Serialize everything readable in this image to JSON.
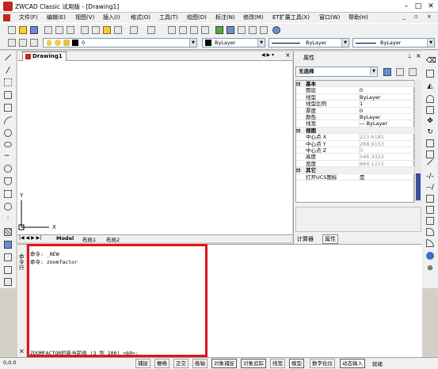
{
  "window": {
    "title": "ZWCAD Classic 试用版 - [Drawing1]"
  },
  "menu": [
    "文件(F)",
    "编辑(E)",
    "视图(V)",
    "插入(I)",
    "格式(O)",
    "工具(T)",
    "绘图(D)",
    "标注(N)",
    "修改(M)",
    "ET扩展工具(X)",
    "窗口(W)",
    "帮助(H)"
  ],
  "toolbar": {
    "layer_value": "0",
    "color_value": "ByLayer",
    "linetype_value": "ByLayer",
    "lineweight_value": "ByLayer"
  },
  "drawing": {
    "tab_label": "Drawing1",
    "axis_y": "Y",
    "axis_x": "X",
    "layout_tabs": [
      "Model",
      "布局1",
      "布局2"
    ]
  },
  "properties": {
    "title": "属性",
    "selection": "无选择",
    "rows": [
      {
        "type": "cat",
        "key": "基本"
      },
      {
        "key": "图层",
        "value": "0"
      },
      {
        "key": "线型",
        "value": "ByLayer"
      },
      {
        "key": "线型比例",
        "value": "1"
      },
      {
        "key": "厚度",
        "value": "0"
      },
      {
        "key": "颜色",
        "value": "ByLayer"
      },
      {
        "key": "线宽",
        "value": "— ByLayer"
      },
      {
        "type": "cat",
        "key": "视图"
      },
      {
        "key": "中心点 X",
        "value": "213.6181",
        "grey": true
      },
      {
        "key": "中心点 Y",
        "value": "268.9153",
        "grey": true
      },
      {
        "key": "中心点 Z",
        "value": "0",
        "grey": true
      },
      {
        "key": "高度",
        "value": "546.3322",
        "grey": true
      },
      {
        "key": "宽度",
        "value": "864.1215",
        "grey": true
      },
      {
        "type": "cat",
        "key": "其它"
      },
      {
        "key": "打开UCS图标",
        "value": "是"
      }
    ],
    "tabs": [
      "计算器",
      "属性"
    ]
  },
  "command": {
    "side_label": "命令行",
    "lines": [
      "命令: _NEW",
      "命令: zoomfactor"
    ],
    "prompt": "ZOOMFACTOR的新当前值 (3 到 100) <60>:"
  },
  "status": [
    "捕捉",
    "栅格",
    "正交",
    "极轴",
    "对象捕捉",
    "对象追踪",
    "线宽",
    "模型",
    "数字化仪",
    "动态输入",
    "就绪"
  ],
  "status_coords": "0,0.0"
}
